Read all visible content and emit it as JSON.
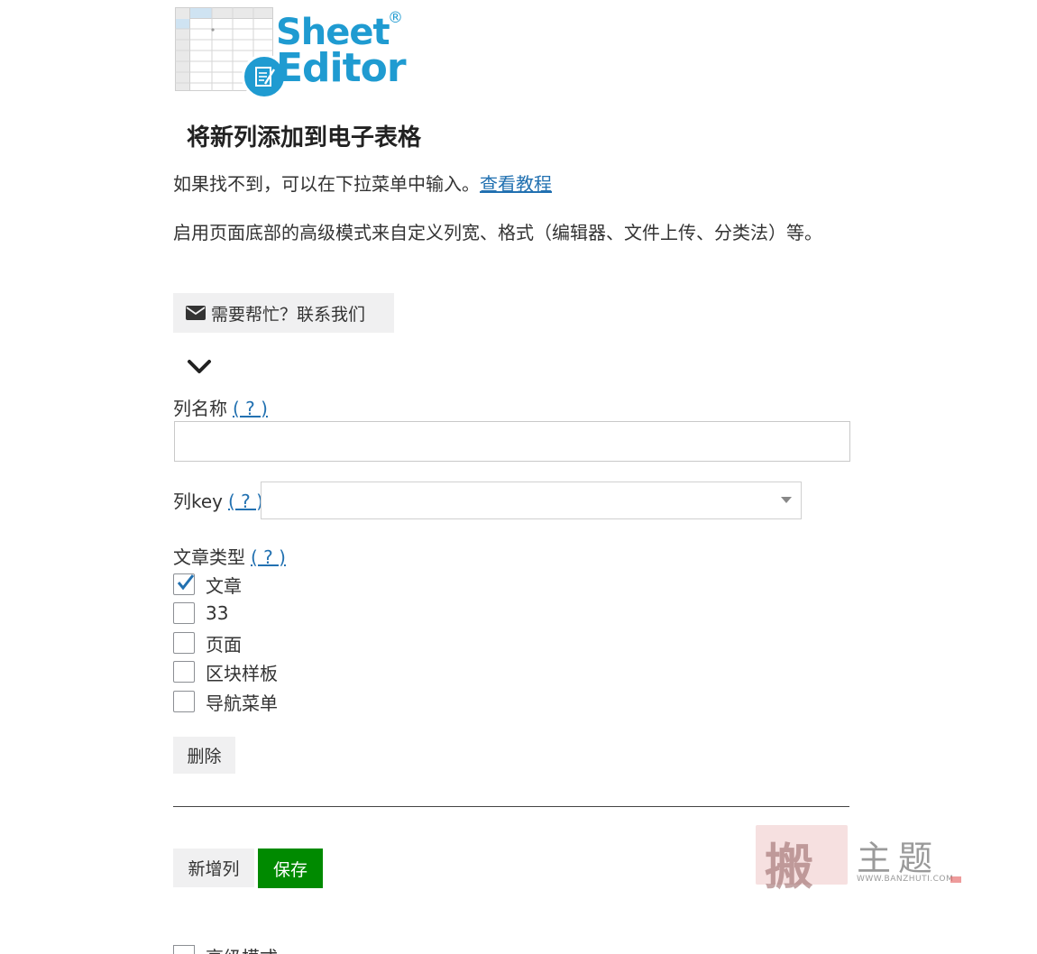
{
  "logo": {
    "line1": "Sheet",
    "reg": "®",
    "line2": "Editor",
    "color": "#1f9bd1"
  },
  "page_title": "将新列添加到电子表格",
  "intro": {
    "text": "如果找不到，可以在下拉菜单中输入。",
    "link": "查看教程"
  },
  "intro2": "启用页面底部的高级模式来自定义列宽、格式（编辑器、文件上传、分类法）等。",
  "help_button": {
    "icon": "envelope-icon",
    "label": "需要帮忙？联系我们"
  },
  "collapse_icon": "chevron-down-icon",
  "column_name": {
    "label": "列名称",
    "help": "( ? )",
    "value": ""
  },
  "column_key": {
    "label": "列key",
    "help": "( ? )",
    "value": ""
  },
  "post_types": {
    "label": "文章类型",
    "help": "( ? )",
    "items": [
      {
        "label": "文章",
        "checked": true
      },
      {
        "label": "33",
        "checked": false
      },
      {
        "label": "页面",
        "checked": false
      },
      {
        "label": "区块样板",
        "checked": false
      },
      {
        "label": "导航菜单",
        "checked": false
      }
    ]
  },
  "delete_button": "删除",
  "add_column_button": "新增列",
  "save_button": "保存",
  "advanced_mode_label": "高级模式",
  "watermark": {
    "seal": "搬",
    "text": "主题",
    "url": "WWW.BANZHUTI.COM"
  },
  "colors": {
    "link": "#2271b1",
    "save": "#008a00",
    "button_gray": "#f0f0f1"
  }
}
